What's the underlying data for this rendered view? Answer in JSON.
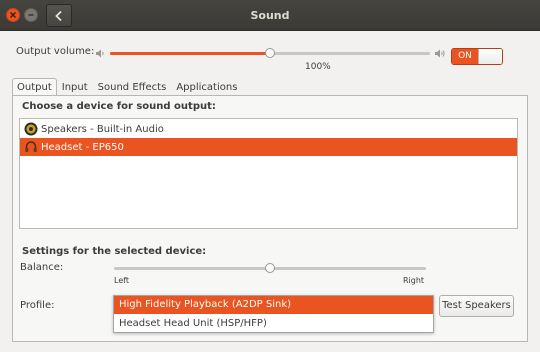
{
  "window": {
    "title": "Sound"
  },
  "volume": {
    "label": "Output volume:",
    "percent_label": "100%",
    "level": 0.5,
    "toggle_label": "ON",
    "toggle_on": true
  },
  "tabs": [
    {
      "label": "Output",
      "active": true
    },
    {
      "label": "Input",
      "active": false
    },
    {
      "label": "Sound Effects",
      "active": false
    },
    {
      "label": "Applications",
      "active": false
    }
  ],
  "output": {
    "choose_heading": "Choose a device for sound output:",
    "devices": [
      {
        "name": "Speakers - Built-in Audio",
        "icon": "speaker-icon",
        "selected": false
      },
      {
        "name": "Headset - EP650",
        "icon": "headset-icon",
        "selected": true
      }
    ],
    "settings_heading": "Settings for the selected device:",
    "balance": {
      "label": "Balance:",
      "left_label": "Left",
      "right_label": "Right",
      "value": 0.5
    },
    "profile": {
      "label": "Profile:",
      "options": [
        {
          "label": "High Fidelity Playback (A2DP Sink)",
          "selected": true
        },
        {
          "label": "Headset Head Unit (HSP/HFP)",
          "selected": false
        }
      ]
    },
    "test_button": "Test Speakers"
  },
  "colors": {
    "accent": "#e95420",
    "titlebar": "#3c3b37",
    "background": "#f2f1f0"
  }
}
